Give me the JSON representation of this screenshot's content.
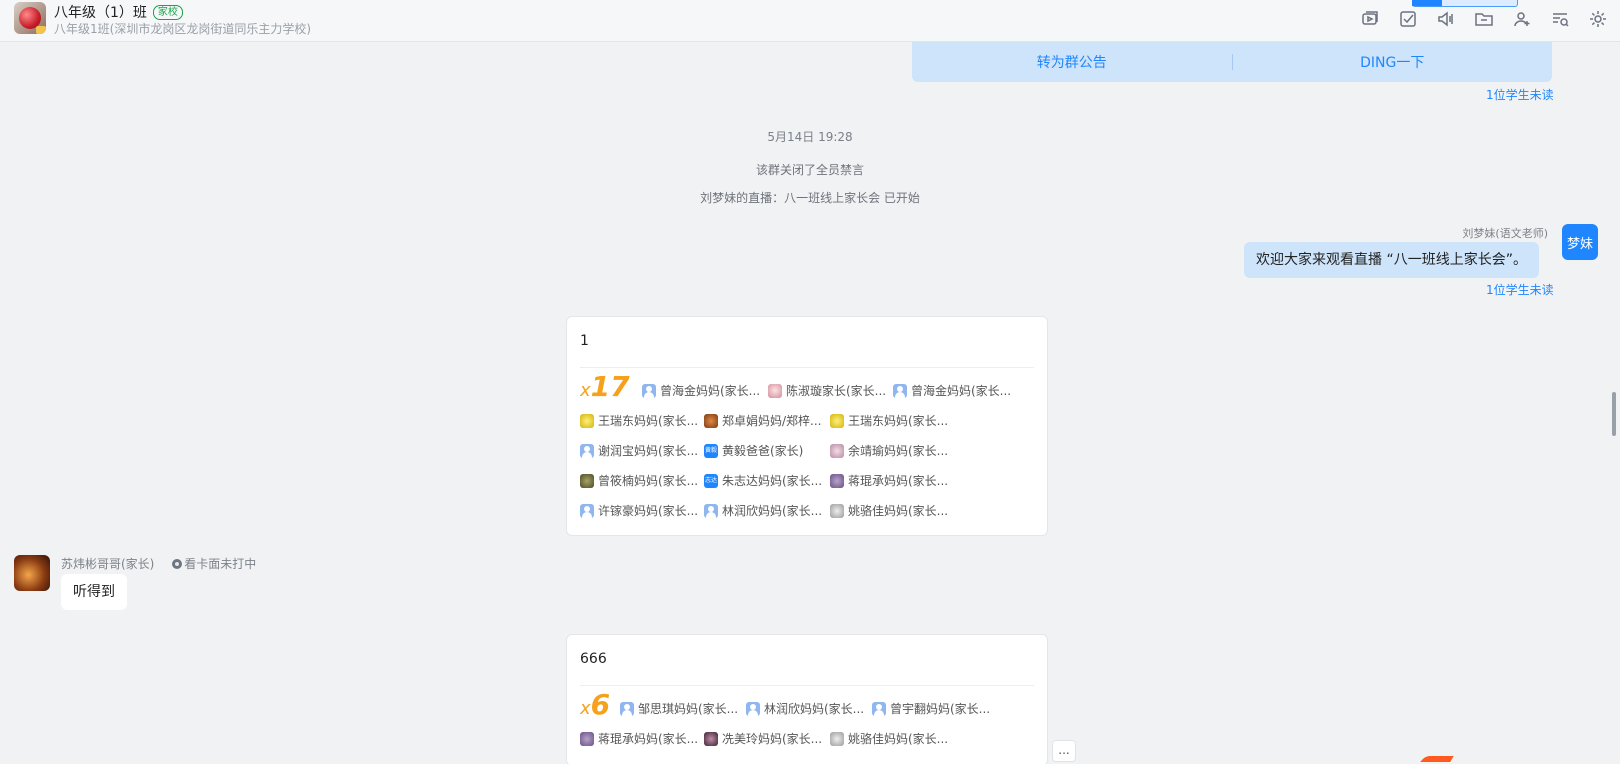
{
  "header": {
    "title": "八年级（1）班",
    "tag": "家校",
    "subtitle": "八年级1班(深圳市龙岗区龙岗街道同乐主力学校)",
    "tools": [
      "live-icon",
      "task-icon",
      "announce-icon",
      "folder-icon",
      "add-member-icon",
      "search-history-icon",
      "settings-icon"
    ]
  },
  "announcement": {
    "to_notice": "转为群公告",
    "ding": "DING一下",
    "unread": "1位学生未读"
  },
  "system": {
    "time": "5月14日 19:28",
    "mute_notice": "该群关闭了全员禁言",
    "live_notice": "刘梦妹的直播：八一班线上家长会 已开始"
  },
  "teacher_msg": {
    "sender": "刘梦妹(语文老师)",
    "avatar_text": "梦妹",
    "text": "欢迎大家来观看直播 “八一班线上家长会”。",
    "unread": "1位学生未读"
  },
  "card1": {
    "text": "1",
    "count_prefix": "x",
    "count": "17",
    "people": [
      {
        "name": "曾海金妈妈(家长...",
        "avatar": "user"
      },
      {
        "name": "陈淑璇家长(家长...",
        "avatar": "pink"
      },
      {
        "name": "曾海金妈妈(家长...",
        "avatar": "user"
      },
      {
        "name": "王瑞东妈妈(家长...",
        "avatar": "yellow"
      },
      {
        "name": "郑卓娟妈妈/郑梓...",
        "avatar": "brown"
      },
      {
        "name": "王瑞东妈妈(家长...",
        "avatar": "yellow"
      },
      {
        "name": "谢润宝妈妈(家长...",
        "avatar": "user"
      },
      {
        "name": "黄毅爸爸(家长)",
        "avatar": "blue",
        "avatar_text": "黄毅"
      },
      {
        "name": "余靖瑜妈妈(家长...",
        "avatar": "lilac"
      },
      {
        "name": "曾筱楠妈妈(家长...",
        "avatar": "olive"
      },
      {
        "name": "朱志达妈妈(家长...",
        "avatar": "blue",
        "avatar_text": "志达"
      },
      {
        "name": "蒋琨承妈妈(家长...",
        "avatar": "violet"
      },
      {
        "name": "许镓豪妈妈(家长...",
        "avatar": "user"
      },
      {
        "name": "林润欣妈妈(家长...",
        "avatar": "user"
      },
      {
        "name": "姚骆佳妈妈(家长...",
        "avatar": "grey"
      }
    ]
  },
  "parent_msg": {
    "sender": "苏炜彬哥哥(家长)",
    "status": "看卡面未打中",
    "text": "听得到"
  },
  "card2": {
    "text": "666",
    "count_prefix": "x",
    "count": "6",
    "people": [
      {
        "name": "邹思琪妈妈(家长...",
        "avatar": "user"
      },
      {
        "name": "林润欣妈妈(家长...",
        "avatar": "user"
      },
      {
        "name": "曾宇翻妈妈(家长...",
        "avatar": "user"
      },
      {
        "name": "蒋琨承妈妈(家长...",
        "avatar": "violet"
      },
      {
        "name": "冼美玲妈妈(家长...",
        "avatar": "dark"
      },
      {
        "name": "姚骆佳妈妈(家长...",
        "avatar": "grey"
      }
    ]
  },
  "more_label": "..."
}
